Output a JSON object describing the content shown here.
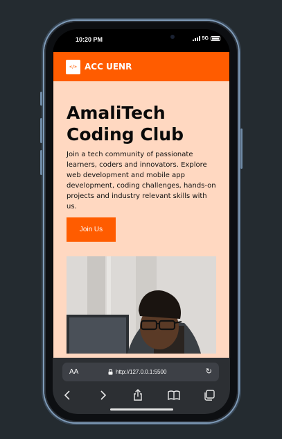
{
  "status_bar": {
    "time": "10:20 PM",
    "network": "5G"
  },
  "navbar": {
    "logo_text": "</>",
    "brand": "ACC UENR"
  },
  "hero": {
    "title": "AmaliTech Coding Club",
    "description": "Join a tech community of passionate learners, coders and innovators. Explore web development and mobile app development, coding challenges, hands-on projects and industry relevant skills with us.",
    "cta_label": "Join Us"
  },
  "browser": {
    "text_size_label": "AA",
    "url": "http://127.0.0.1:5500"
  },
  "icons": [
    "back-icon",
    "forward-icon",
    "share-icon",
    "bookmarks-icon",
    "tabs-icon",
    "lock-icon",
    "reload-icon"
  ],
  "colors": {
    "accent": "#ff5c00",
    "page_bg": "#ffd8c1",
    "device_bg": "#242b30"
  }
}
